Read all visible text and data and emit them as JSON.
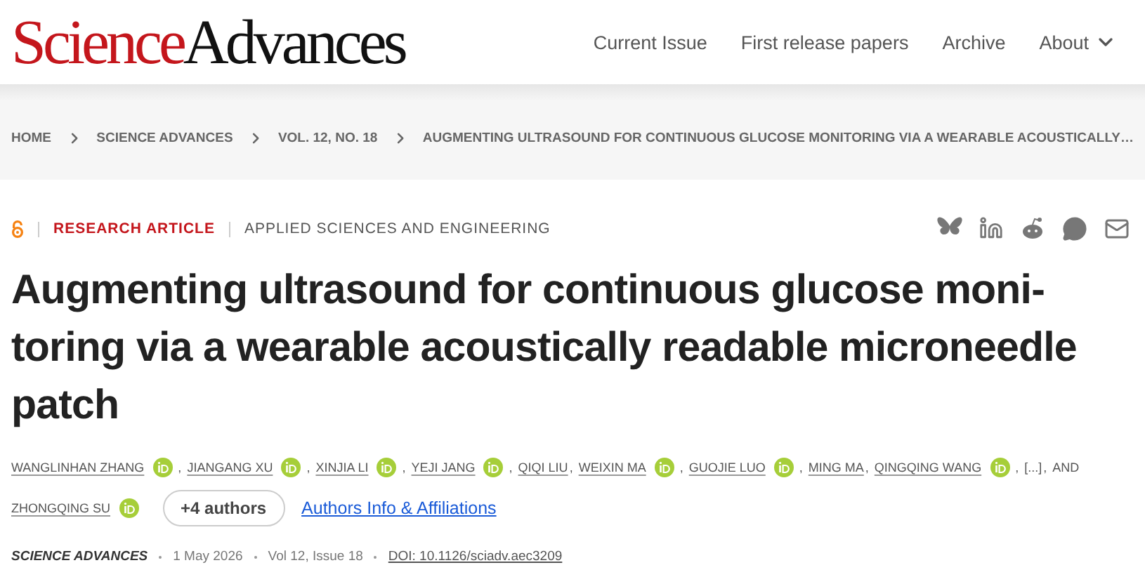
{
  "logo": {
    "part_1": "Science",
    "part_2": "Advances"
  },
  "nav": [
    {
      "label": "Current Issue",
      "dropdown": false
    },
    {
      "label": "First release papers",
      "dropdown": false
    },
    {
      "label": "Archive",
      "dropdown": false
    },
    {
      "label": "About",
      "dropdown": true
    }
  ],
  "breadcrumb": [
    "HOME",
    "SCIENCE ADVANCES",
    "VOL. 12, NO. 18",
    "AUGMENTING ULTRASOUND FOR CONTINUOUS GLUCOSE MONITORING VIA A WEARABLE ACOUSTICALLY…"
  ],
  "article_type": {
    "open_access": true,
    "type": "RESEARCH ARTICLE",
    "subject": "APPLIED SCIENCES AND ENGINEERING"
  },
  "title_lines": [
    "Augmenting ultrasound for continuous glucose moni-",
    "toring via a wearable acoustically readable microneedle",
    "patch"
  ],
  "authors": [
    {
      "kind": "name",
      "text": "WANGLINHAN ZHANG",
      "orcid": true,
      "trail": ","
    },
    {
      "kind": "name",
      "text": "JIANGANG XU",
      "orcid": true,
      "trail": ","
    },
    {
      "kind": "name",
      "text": "XINJIA LI",
      "orcid": true,
      "trail": ","
    },
    {
      "kind": "name",
      "text": "YEJI JANG",
      "orcid": true,
      "trail": ","
    },
    {
      "kind": "name",
      "text": "QIQI LIU",
      "orcid": false,
      "trail": ","
    },
    {
      "kind": "name",
      "text": "WEIXIN MA",
      "orcid": true,
      "trail": ","
    },
    {
      "kind": "name",
      "text": "GUOJIE LUO",
      "orcid": true,
      "trail": ","
    },
    {
      "kind": "name",
      "text": "MING MA",
      "orcid": false,
      "trail": ","
    },
    {
      "kind": "name",
      "text": "QINGQING WANG",
      "orcid": true,
      "trail": ","
    },
    {
      "kind": "text",
      "text": "[...]",
      "orcid": false,
      "trail": ","
    },
    {
      "kind": "text",
      "text": "AND",
      "orcid": false
    },
    {
      "kind": "name",
      "text": "ZHONGQING SU",
      "orcid": true
    }
  ],
  "more_authors": "+4 authors",
  "affiliations_link": "Authors Info & Affiliations",
  "meta": {
    "journal": "SCIENCE ADVANCES",
    "date": "1 May 2026",
    "issue": "Vol 12, Issue 18",
    "doi": "DOI: 10.1126/sciadv.aec3209"
  }
}
